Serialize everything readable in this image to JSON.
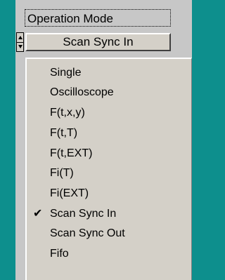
{
  "group": {
    "title": "Operation Mode"
  },
  "combo": {
    "value": "Scan Sync In"
  },
  "menu": {
    "items": [
      {
        "label": "Single",
        "checked": false
      },
      {
        "label": "Oscilloscope",
        "checked": false
      },
      {
        "label": "F(t,x,y)",
        "checked": false
      },
      {
        "label": "F(t,T)",
        "checked": false
      },
      {
        "label": "F(t,EXT)",
        "checked": false
      },
      {
        "label": "Fi(T)",
        "checked": false
      },
      {
        "label": "Fi(EXT)",
        "checked": false
      },
      {
        "label": "Scan Sync In",
        "checked": true
      },
      {
        "label": "Scan Sync Out",
        "checked": false
      },
      {
        "label": "Fifo",
        "checked": false
      }
    ],
    "check_glyph": "✔"
  }
}
